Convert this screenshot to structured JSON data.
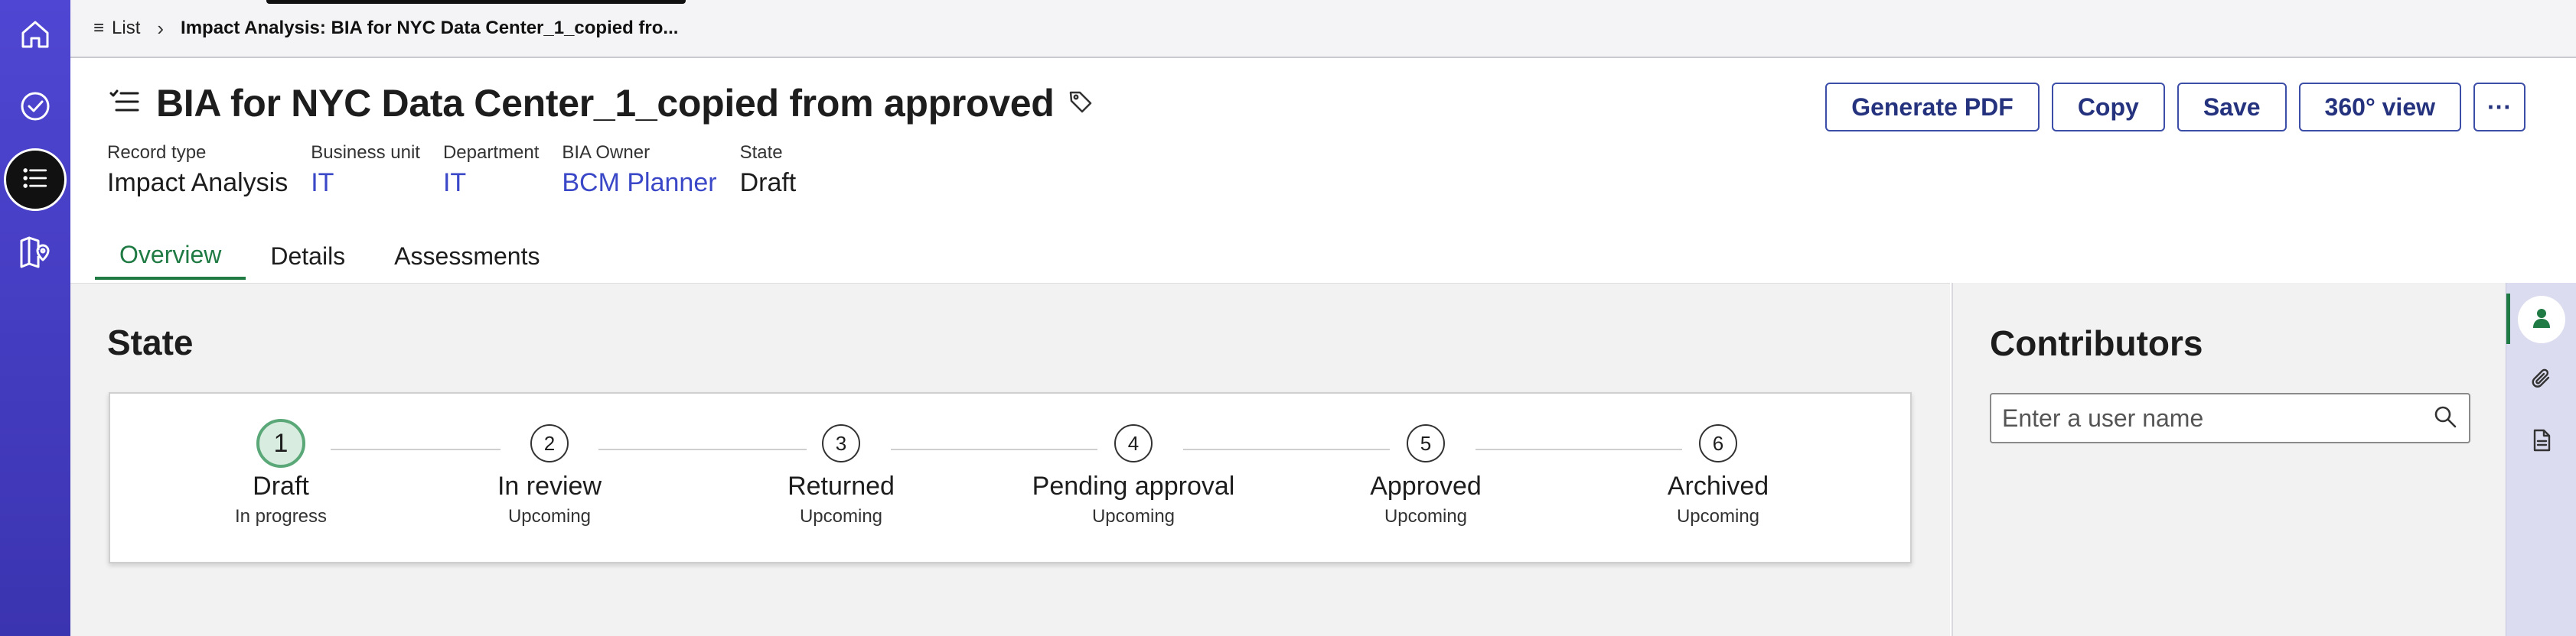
{
  "rail": {
    "items": [
      {
        "icon": "home-icon"
      },
      {
        "icon": "check-circle-icon"
      },
      {
        "icon": "list-icon",
        "active": true
      },
      {
        "icon": "map-pin-book-icon"
      }
    ]
  },
  "breadcrumb": {
    "list_label": "List",
    "current": "Impact Analysis: BIA for NYC Data Center_1_copied fro..."
  },
  "header": {
    "title": "BIA for NYC Data Center_1_copied from approved",
    "actions": {
      "generate_pdf": "Generate PDF",
      "copy": "Copy",
      "save": "Save",
      "view360": "360° view",
      "more": "···"
    },
    "meta": [
      {
        "label": "Record type",
        "value": "Impact Analysis",
        "link": false
      },
      {
        "label": "Business unit",
        "value": "IT",
        "link": true
      },
      {
        "label": "Department",
        "value": "IT",
        "link": true
      },
      {
        "label": "BIA Owner",
        "value": "BCM Planner",
        "link": true
      },
      {
        "label": "State",
        "value": "Draft",
        "link": false
      }
    ],
    "tabs": [
      "Overview",
      "Details",
      "Assessments"
    ],
    "active_tab": "Overview"
  },
  "state_section": {
    "title": "State",
    "steps": [
      {
        "num": "1",
        "name": "Draft",
        "status": "In progress",
        "current": true
      },
      {
        "num": "2",
        "name": "In review",
        "status": "Upcoming"
      },
      {
        "num": "3",
        "name": "Returned",
        "status": "Upcoming"
      },
      {
        "num": "4",
        "name": "Pending approval",
        "status": "Upcoming"
      },
      {
        "num": "5",
        "name": "Approved",
        "status": "Upcoming"
      },
      {
        "num": "6",
        "name": "Archived",
        "status": "Upcoming"
      }
    ]
  },
  "contributors": {
    "title": "Contributors",
    "search_placeholder": "Enter a user name"
  },
  "side_tools": [
    "person-icon",
    "paperclip-icon",
    "document-icon"
  ],
  "colors": {
    "rail": "#4f46d3",
    "accent_green": "#1f7a43",
    "link_blue": "#3a48c8",
    "button_border": "#3c4ea8"
  }
}
